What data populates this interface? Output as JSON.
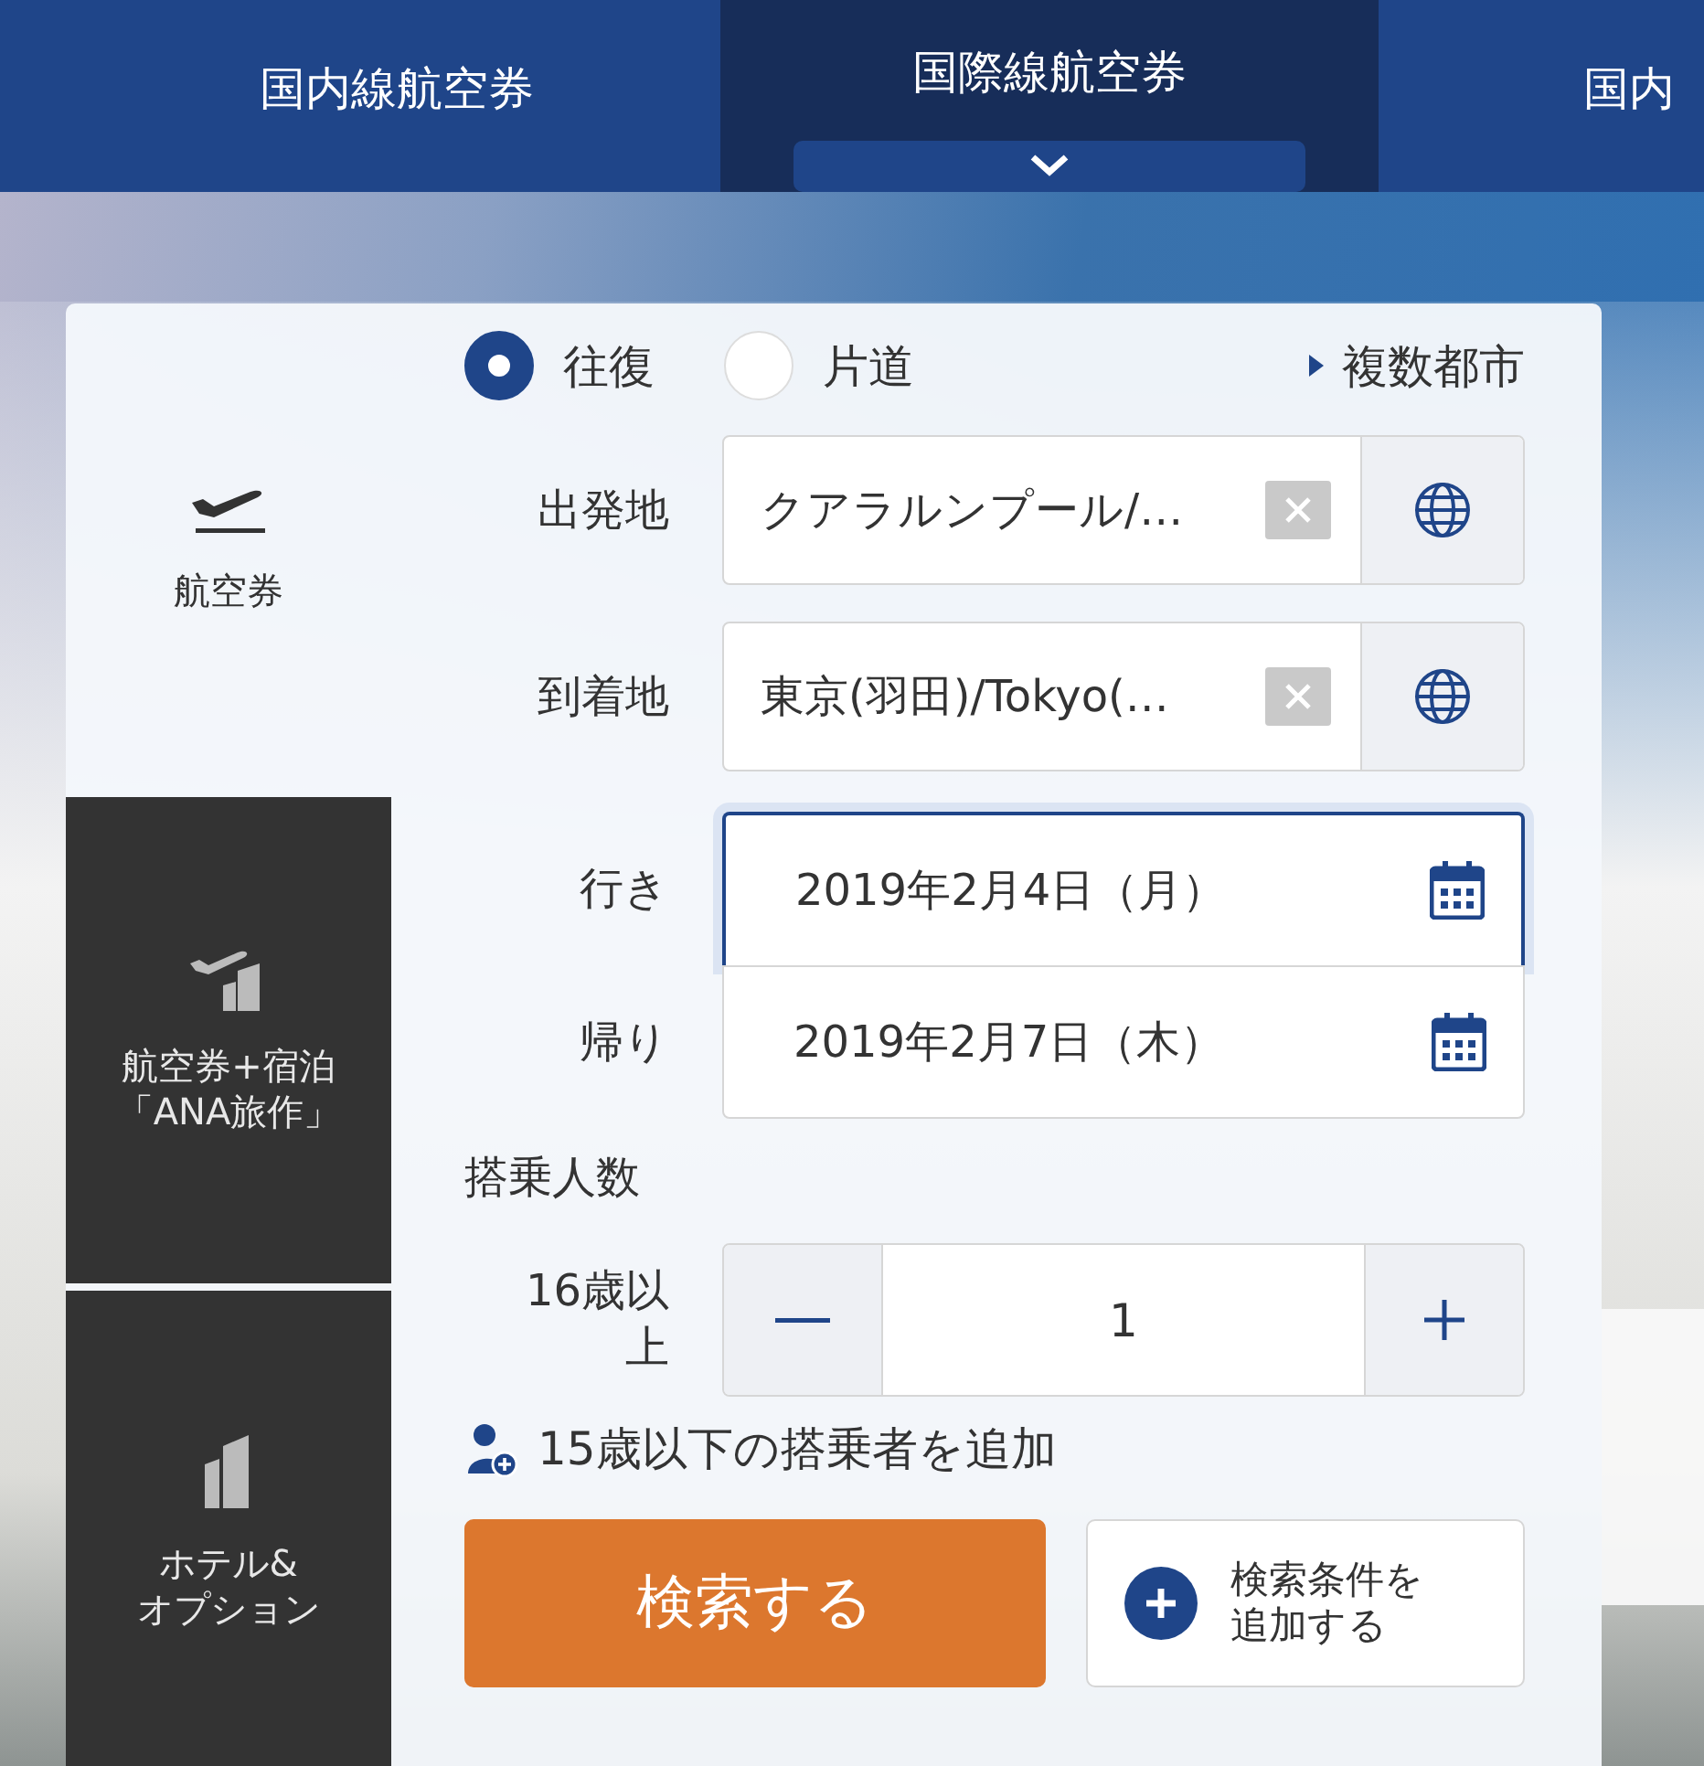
{
  "nav_tabs": [
    {
      "label": "国内線航空券",
      "selected": false
    },
    {
      "label": "国際線航空券",
      "selected": true
    },
    {
      "label": "国内",
      "selected": false
    }
  ],
  "sidebar": {
    "items": [
      {
        "kind": "flight",
        "lines": [
          "航空券"
        ],
        "selected": true
      },
      {
        "kind": "flight_hotel",
        "lines": [
          "航空券+宿泊",
          "「ANA旅作」"
        ],
        "selected": false
      },
      {
        "kind": "hotel",
        "lines": [
          "ホテル&",
          "オプション"
        ],
        "selected": false
      }
    ]
  },
  "trip_type": {
    "options": [
      {
        "label": "往復",
        "selected": true
      },
      {
        "label": "片道",
        "selected": false
      }
    ],
    "multi_city": "複数都市"
  },
  "places": [
    {
      "label": "出発地",
      "value": "クアラルンプール/…"
    },
    {
      "label": "到着地",
      "value": "東京(羽田)/Tokyo(…"
    }
  ],
  "dates": [
    {
      "label": "行き",
      "value": "2019年2月4日（月）",
      "focused": true
    },
    {
      "label": "帰り",
      "value": "2019年2月7日（木）",
      "focused": false
    }
  ],
  "passengers": {
    "heading": "搭乗人数",
    "rows": [
      {
        "label": "16歳以上",
        "value": "1"
      }
    ],
    "add_child": "15歳以下の搭乗者を追加"
  },
  "search_button": "検索する",
  "add_conditions_button": [
    "検索条件を",
    "追加する"
  ]
}
